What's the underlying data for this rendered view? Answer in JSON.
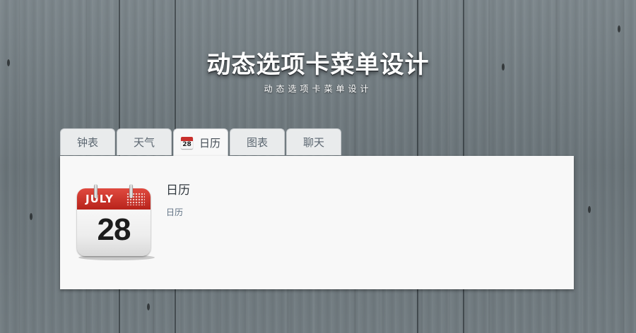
{
  "header": {
    "title": "动态选项卡菜单设计",
    "subtitle": "动态选项卡菜单设计"
  },
  "tabs": [
    {
      "label": "钟表",
      "active": false
    },
    {
      "label": "天气",
      "active": false
    },
    {
      "label": "日历",
      "active": true,
      "icon": "calendar-icon",
      "icon_day": "28"
    },
    {
      "label": "图表",
      "active": false
    },
    {
      "label": "聊天",
      "active": false
    }
  ],
  "panel": {
    "icon": "calendar-icon",
    "calendar_month": "JULY",
    "calendar_day": "28",
    "title": "日历",
    "text": "日历"
  },
  "colors": {
    "background": "#6f7a7f",
    "panel": "#f8f8f8",
    "tab": "#e9ebec",
    "calendar_red": "#c9302c"
  }
}
